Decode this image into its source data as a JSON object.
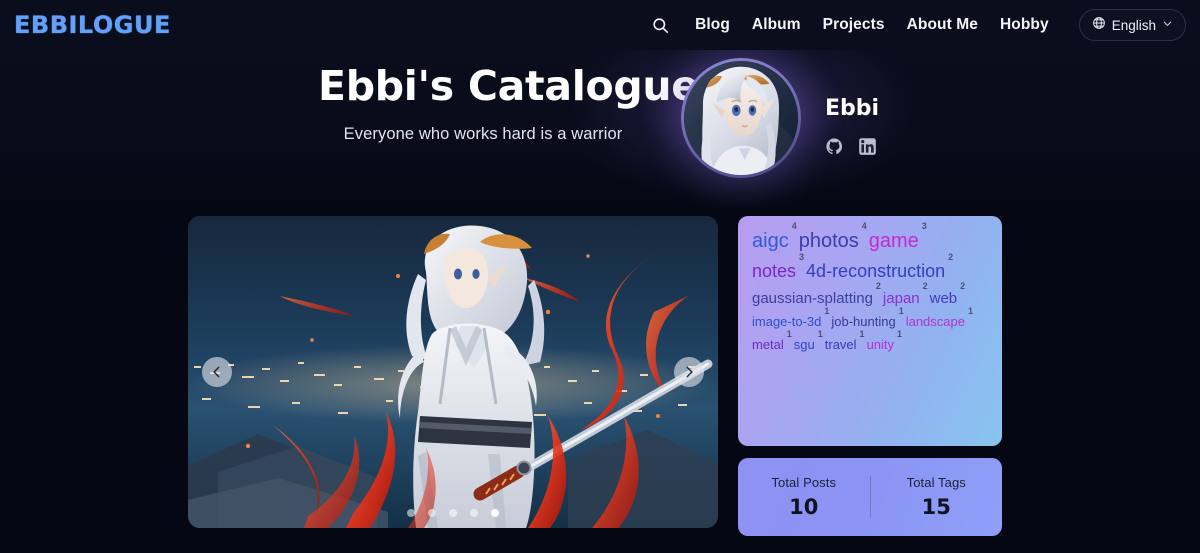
{
  "header": {
    "logo": "EBBILOGUE",
    "search_icon": "search-icon",
    "nav_items": [
      {
        "label": "Blog"
      },
      {
        "label": "Album"
      },
      {
        "label": "Projects"
      },
      {
        "label": "About Me"
      },
      {
        "label": "Hobby"
      }
    ],
    "language": {
      "label": "English",
      "globe_icon": "globe-icon",
      "chevron_icon": "chevron-down-icon"
    }
  },
  "hero": {
    "title": "Ebbi's Catalogue",
    "subtitle": "Everyone who works hard is a warrior",
    "profile": {
      "name": "Ebbi",
      "avatar_alt": "avatar",
      "socials": [
        {
          "name": "github-icon",
          "label": "GitHub"
        },
        {
          "name": "linkedin-icon",
          "label": "LinkedIn"
        }
      ]
    }
  },
  "main": {
    "carousel": {
      "prev_label": "‹",
      "next_label": "›",
      "slide_count": 5,
      "active_index": 4,
      "image_alt": "Anime warrior with katana and flame ribbons over a night city"
    },
    "tag_cloud": {
      "rows": [
        [
          {
            "label": "aigc",
            "count": "4",
            "size": 20,
            "color": "#2f5bd8"
          },
          {
            "label": "photos",
            "count": "4",
            "size": 20,
            "color": "#3a3fae"
          },
          {
            "label": "game",
            "count": "3",
            "size": 20,
            "color": "#c42ad4"
          }
        ],
        [
          {
            "label": "notes",
            "count": "3",
            "size": 18,
            "color": "#7a26c9"
          },
          {
            "label": "4d-reconstruction",
            "count": "2",
            "size": 18,
            "color": "#2f3fc2"
          }
        ],
        [
          {
            "label": "gaussian-splatting",
            "count": "2",
            "size": 15,
            "color": "#3c3f9e"
          },
          {
            "label": "japan",
            "count": "2",
            "size": 15,
            "color": "#8a2fd2"
          },
          {
            "label": "web",
            "count": "2",
            "size": 15,
            "color": "#4338c4"
          }
        ],
        [
          {
            "label": "image-to-3d",
            "count": "1",
            "size": 13,
            "color": "#2b4fd0"
          },
          {
            "label": "job-hunting",
            "count": "1",
            "size": 13,
            "color": "#353a9a"
          },
          {
            "label": "landscape",
            "count": "1",
            "size": 13,
            "color": "#b134d6"
          }
        ],
        [
          {
            "label": "metal",
            "count": "1",
            "size": 13,
            "color": "#7028c4"
          },
          {
            "label": "sgu",
            "count": "1",
            "size": 13,
            "color": "#2f46c8"
          },
          {
            "label": "travel",
            "count": "1",
            "size": 13,
            "color": "#3a3cb0"
          },
          {
            "label": "unity",
            "count": "1",
            "size": 13,
            "color": "#b82fd6"
          }
        ]
      ]
    },
    "stats": [
      {
        "label": "Total Posts",
        "value": "10"
      },
      {
        "label": "Total Tags",
        "value": "15"
      }
    ]
  }
}
